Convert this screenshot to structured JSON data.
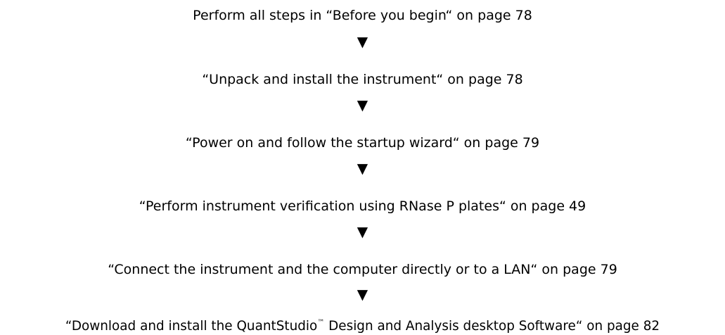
{
  "flow": {
    "arrow_glyph": "▼",
    "steps": [
      {
        "text": "Perform all steps in “Before you begin“ on page 78"
      },
      {
        "text": "“Unpack and install the instrument“ on page 78"
      },
      {
        "text": "“Power on and follow the startup wizard“ on page 79"
      },
      {
        "text": "“Perform instrument verification using RNase P plates“ on page 49"
      },
      {
        "text": "“Connect the instrument and the computer directly or to a LAN“ on page 79"
      },
      {
        "text_before": "“Download and install the QuantStudio",
        "trademark": "™",
        "text_after": " Design and Analysis desktop Software“ on page 82"
      }
    ]
  }
}
